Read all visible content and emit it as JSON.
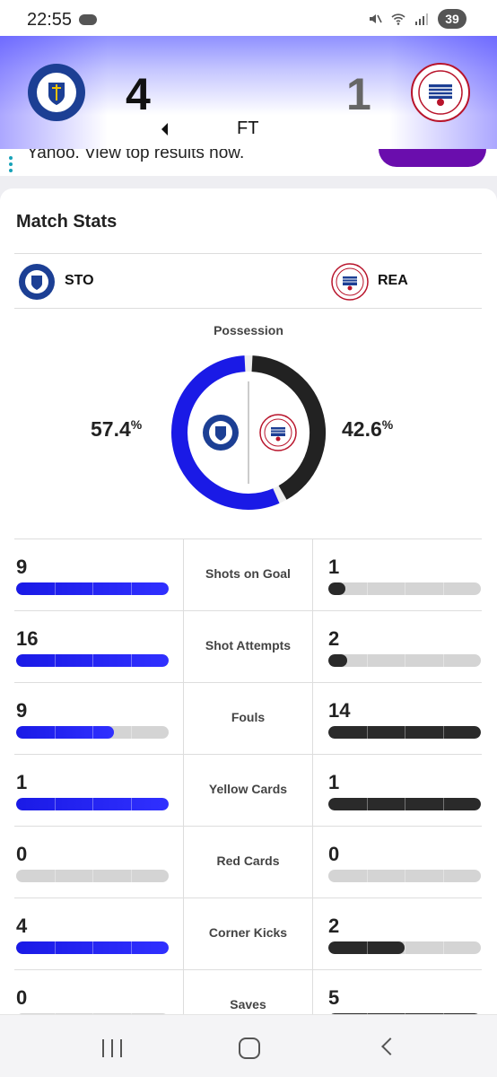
{
  "status_bar": {
    "time": "22:55",
    "battery": "39"
  },
  "match": {
    "home_score": "4",
    "away_score": "1",
    "status": "FT"
  },
  "ad": {
    "text": "Yahoo. View top results now."
  },
  "card": {
    "title": "Match Stats",
    "home_team": "STO",
    "away_team": "REA"
  },
  "possession": {
    "label": "Possession",
    "home_value": "57.4",
    "away_value": "42.6",
    "unit": "%",
    "home_pct": 57.4,
    "away_pct": 42.6
  },
  "stats": [
    {
      "name": "Shots on Goal",
      "home": "9",
      "away": "1",
      "home_fill": 1.0,
      "away_fill": 0.11,
      "away_color": "dark"
    },
    {
      "name": "Shot Attempts",
      "home": "16",
      "away": "2",
      "home_fill": 1.0,
      "away_fill": 0.125,
      "away_color": "dark"
    },
    {
      "name": "Fouls",
      "home": "9",
      "away": "14",
      "home_fill": 0.64,
      "away_fill": 1.0,
      "away_color": "dark"
    },
    {
      "name": "Yellow Cards",
      "home": "1",
      "away": "1",
      "home_fill": 1.0,
      "away_fill": 1.0,
      "away_color": "dark"
    },
    {
      "name": "Red Cards",
      "home": "0",
      "away": "0",
      "home_fill": 0,
      "away_fill": 0,
      "away_color": "dark"
    },
    {
      "name": "Corner Kicks",
      "home": "4",
      "away": "2",
      "home_fill": 1.0,
      "away_fill": 0.5,
      "away_color": "dark"
    },
    {
      "name": "Saves",
      "home": "0",
      "away": "5",
      "home_fill": 0,
      "away_fill": 1.0,
      "away_color": "dark"
    }
  ],
  "colors": {
    "home": "#1a1ae6",
    "away": "#222222"
  }
}
